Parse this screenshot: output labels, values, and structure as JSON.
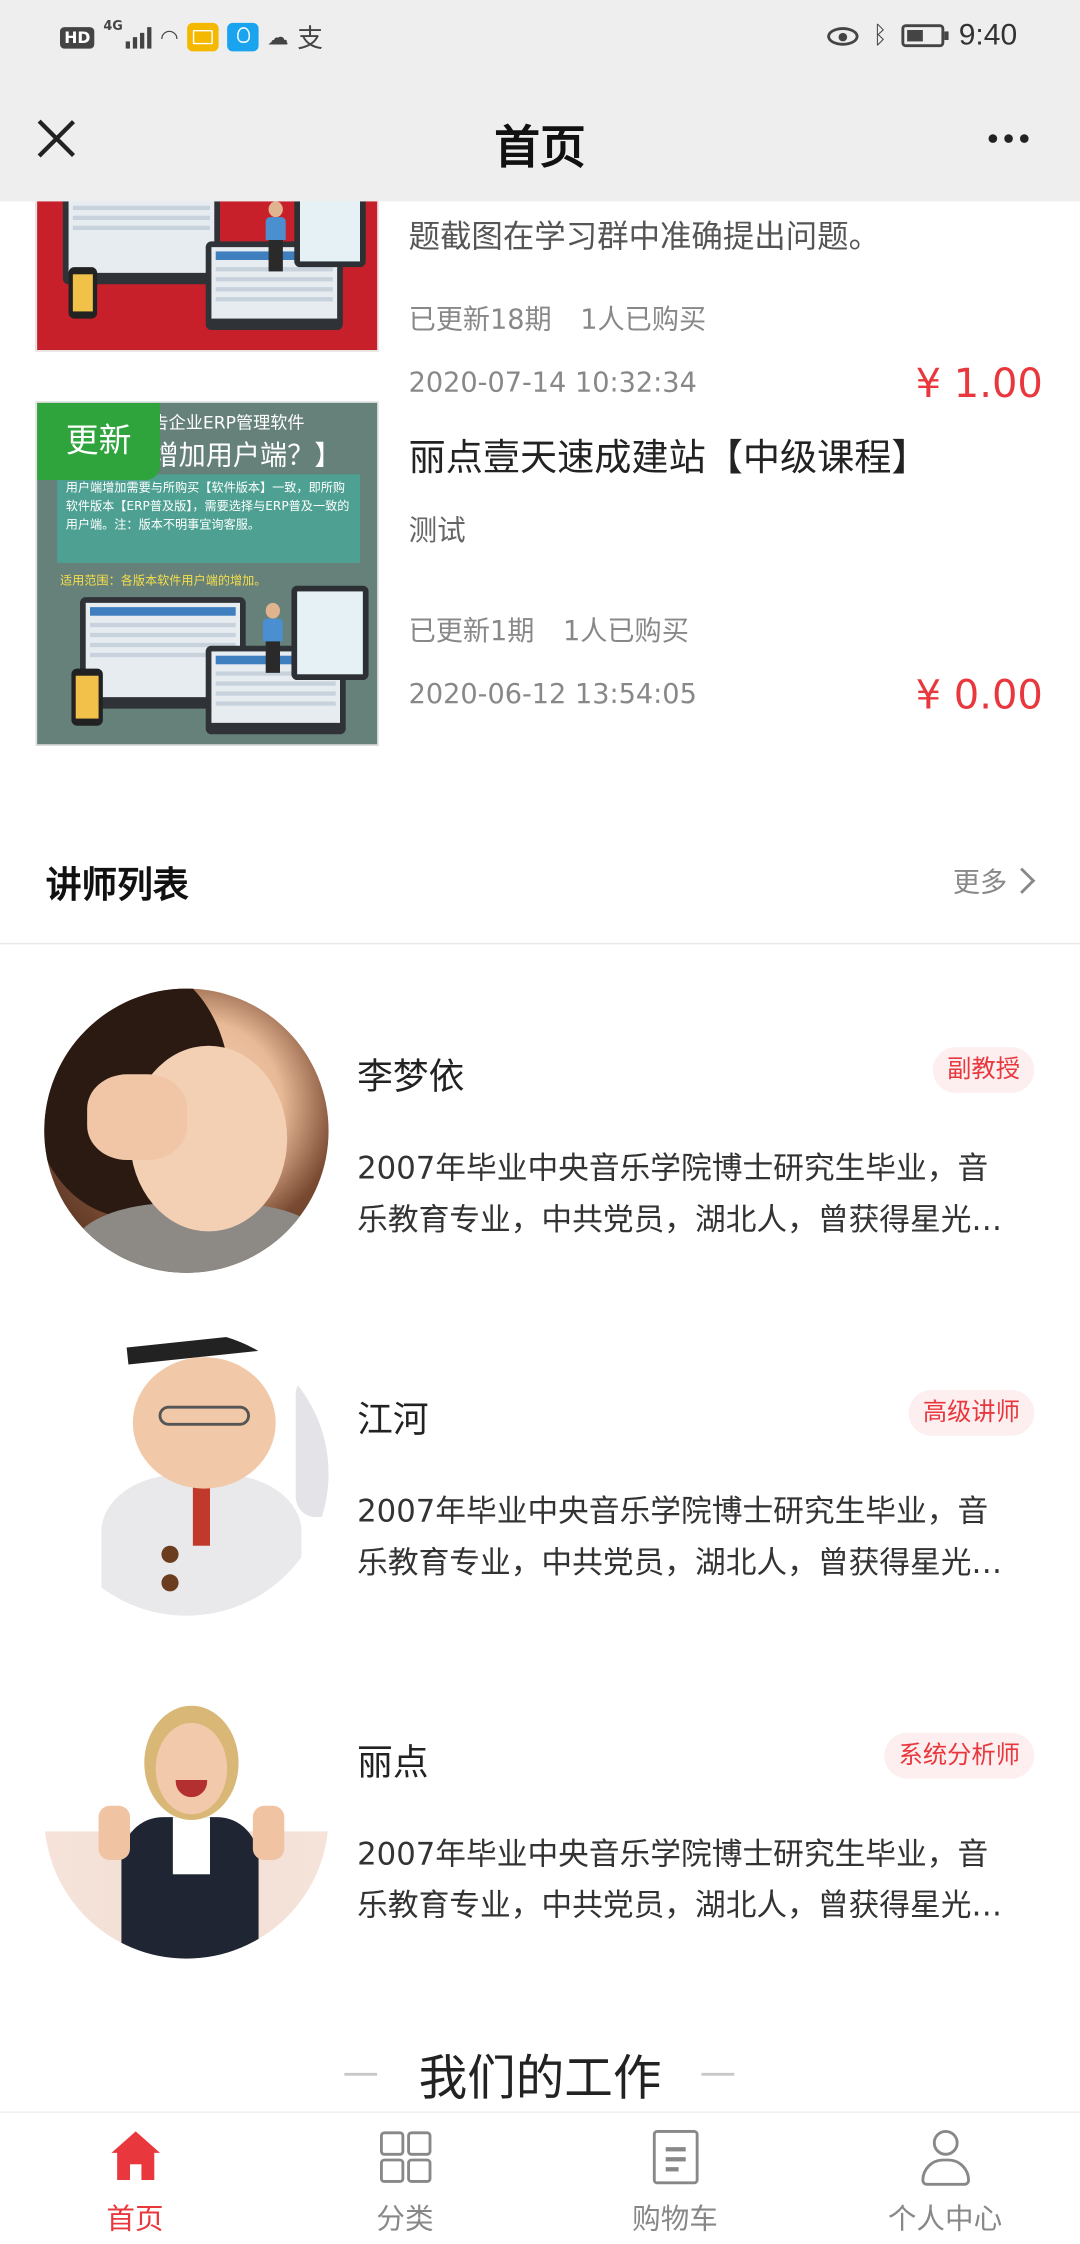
{
  "status_bar": {
    "time": "9:40",
    "network": "4G",
    "hd": "HD",
    "icons": [
      "hd-icon",
      "signal-icon",
      "wifi-icon",
      "mail-icon",
      "bulb-icon",
      "cloud-icon",
      "alipay-icon",
      "eye-icon",
      "bluetooth-icon",
      "battery-icon"
    ]
  },
  "nav": {
    "title": "首页",
    "close_icon": "close-icon",
    "more_icon": "more-icon"
  },
  "courses": [
    {
      "desc": "题截图在学习群中准确提出问题。",
      "meta_updated": "已更新18期",
      "meta_bought": "1人已购买",
      "date": "2020-07-14 10:32:34",
      "price": "¥ 1.00"
    },
    {
      "badge": "更新",
      "thumb_title": "告企业ERP管理软件",
      "thumb_subtitle": "增加用户端？】",
      "thumb_note": "用户端增加需要与所购买【软件版本】一致，即所购软件版本【ERP普及版】，需要选择与ERP普及一致的用户端。注：版本不明事宜询客服。",
      "thumb_range": "适用范围：各版本软件用户端的增加。",
      "title": "丽点壹天速成建站【中级课程】",
      "desc": "测试",
      "meta_updated": "已更新1期",
      "meta_bought": "1人已购买",
      "date": "2020-06-12 13:54:05",
      "price": "¥ 0.00"
    }
  ],
  "teachers_section": {
    "title": "讲师列表",
    "more": "更多",
    "items": [
      {
        "name": "李梦依",
        "badge": "副教授",
        "desc_line1": "2007年毕业中央音乐学院博士研究生毕业，音",
        "desc_line2": "乐教育专业，中共党员，湖北人，曾获得星光…"
      },
      {
        "name": "江河",
        "badge": "高级讲师",
        "desc_line1": "2007年毕业中央音乐学院博士研究生毕业，音",
        "desc_line2": "乐教育专业，中共党员，湖北人，曾获得星光…"
      },
      {
        "name": "丽点",
        "badge": "系统分析师",
        "desc_line1": "2007年毕业中央音乐学院博士研究生毕业，音",
        "desc_line2": "乐教育专业，中共党员，湖北人，曾获得星光…"
      }
    ]
  },
  "work_section": {
    "title": "我们的工作"
  },
  "tabbar": {
    "items": [
      {
        "label": "首页",
        "icon": "home-icon",
        "active": true
      },
      {
        "label": "分类",
        "icon": "grid-icon",
        "active": false
      },
      {
        "label": "购物车",
        "icon": "cart-doc-icon",
        "active": false
      },
      {
        "label": "个人中心",
        "icon": "user-icon",
        "active": false
      }
    ]
  },
  "colors": {
    "accent": "#e8383d",
    "badge_bg": "#fdeef0",
    "new_badge": "#2fa33c",
    "bar_bg": "#eeeeee"
  }
}
